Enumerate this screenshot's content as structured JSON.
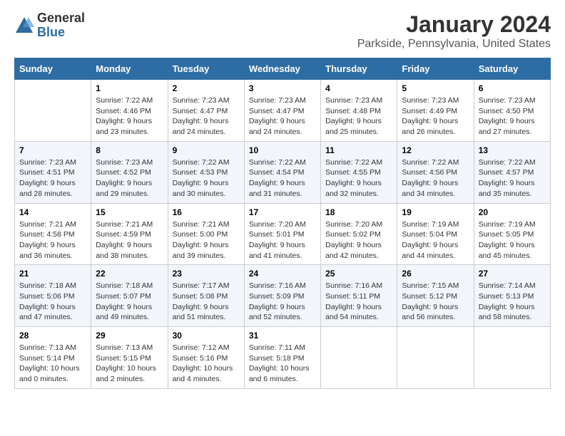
{
  "app": {
    "logo_general": "General",
    "logo_blue": "Blue"
  },
  "header": {
    "title": "January 2024",
    "subtitle": "Parkside, Pennsylvania, United States"
  },
  "calendar": {
    "columns": [
      "Sunday",
      "Monday",
      "Tuesday",
      "Wednesday",
      "Thursday",
      "Friday",
      "Saturday"
    ],
    "weeks": [
      [
        {
          "day": "",
          "info": ""
        },
        {
          "day": "1",
          "info": "Sunrise: 7:22 AM\nSunset: 4:46 PM\nDaylight: 9 hours\nand 23 minutes."
        },
        {
          "day": "2",
          "info": "Sunrise: 7:23 AM\nSunset: 4:47 PM\nDaylight: 9 hours\nand 24 minutes."
        },
        {
          "day": "3",
          "info": "Sunrise: 7:23 AM\nSunset: 4:47 PM\nDaylight: 9 hours\nand 24 minutes."
        },
        {
          "day": "4",
          "info": "Sunrise: 7:23 AM\nSunset: 4:48 PM\nDaylight: 9 hours\nand 25 minutes."
        },
        {
          "day": "5",
          "info": "Sunrise: 7:23 AM\nSunset: 4:49 PM\nDaylight: 9 hours\nand 26 minutes."
        },
        {
          "day": "6",
          "info": "Sunrise: 7:23 AM\nSunset: 4:50 PM\nDaylight: 9 hours\nand 27 minutes."
        }
      ],
      [
        {
          "day": "7",
          "info": "Sunrise: 7:23 AM\nSunset: 4:51 PM\nDaylight: 9 hours\nand 28 minutes."
        },
        {
          "day": "8",
          "info": "Sunrise: 7:23 AM\nSunset: 4:52 PM\nDaylight: 9 hours\nand 29 minutes."
        },
        {
          "day": "9",
          "info": "Sunrise: 7:22 AM\nSunset: 4:53 PM\nDaylight: 9 hours\nand 30 minutes."
        },
        {
          "day": "10",
          "info": "Sunrise: 7:22 AM\nSunset: 4:54 PM\nDaylight: 9 hours\nand 31 minutes."
        },
        {
          "day": "11",
          "info": "Sunrise: 7:22 AM\nSunset: 4:55 PM\nDaylight: 9 hours\nand 32 minutes."
        },
        {
          "day": "12",
          "info": "Sunrise: 7:22 AM\nSunset: 4:56 PM\nDaylight: 9 hours\nand 34 minutes."
        },
        {
          "day": "13",
          "info": "Sunrise: 7:22 AM\nSunset: 4:57 PM\nDaylight: 9 hours\nand 35 minutes."
        }
      ],
      [
        {
          "day": "14",
          "info": "Sunrise: 7:21 AM\nSunset: 4:58 PM\nDaylight: 9 hours\nand 36 minutes."
        },
        {
          "day": "15",
          "info": "Sunrise: 7:21 AM\nSunset: 4:59 PM\nDaylight: 9 hours\nand 38 minutes."
        },
        {
          "day": "16",
          "info": "Sunrise: 7:21 AM\nSunset: 5:00 PM\nDaylight: 9 hours\nand 39 minutes."
        },
        {
          "day": "17",
          "info": "Sunrise: 7:20 AM\nSunset: 5:01 PM\nDaylight: 9 hours\nand 41 minutes."
        },
        {
          "day": "18",
          "info": "Sunrise: 7:20 AM\nSunset: 5:02 PM\nDaylight: 9 hours\nand 42 minutes."
        },
        {
          "day": "19",
          "info": "Sunrise: 7:19 AM\nSunset: 5:04 PM\nDaylight: 9 hours\nand 44 minutes."
        },
        {
          "day": "20",
          "info": "Sunrise: 7:19 AM\nSunset: 5:05 PM\nDaylight: 9 hours\nand 45 minutes."
        }
      ],
      [
        {
          "day": "21",
          "info": "Sunrise: 7:18 AM\nSunset: 5:06 PM\nDaylight: 9 hours\nand 47 minutes."
        },
        {
          "day": "22",
          "info": "Sunrise: 7:18 AM\nSunset: 5:07 PM\nDaylight: 9 hours\nand 49 minutes."
        },
        {
          "day": "23",
          "info": "Sunrise: 7:17 AM\nSunset: 5:08 PM\nDaylight: 9 hours\nand 51 minutes."
        },
        {
          "day": "24",
          "info": "Sunrise: 7:16 AM\nSunset: 5:09 PM\nDaylight: 9 hours\nand 52 minutes."
        },
        {
          "day": "25",
          "info": "Sunrise: 7:16 AM\nSunset: 5:11 PM\nDaylight: 9 hours\nand 54 minutes."
        },
        {
          "day": "26",
          "info": "Sunrise: 7:15 AM\nSunset: 5:12 PM\nDaylight: 9 hours\nand 56 minutes."
        },
        {
          "day": "27",
          "info": "Sunrise: 7:14 AM\nSunset: 5:13 PM\nDaylight: 9 hours\nand 58 minutes."
        }
      ],
      [
        {
          "day": "28",
          "info": "Sunrise: 7:13 AM\nSunset: 5:14 PM\nDaylight: 10 hours\nand 0 minutes."
        },
        {
          "day": "29",
          "info": "Sunrise: 7:13 AM\nSunset: 5:15 PM\nDaylight: 10 hours\nand 2 minutes."
        },
        {
          "day": "30",
          "info": "Sunrise: 7:12 AM\nSunset: 5:16 PM\nDaylight: 10 hours\nand 4 minutes."
        },
        {
          "day": "31",
          "info": "Sunrise: 7:11 AM\nSunset: 5:18 PM\nDaylight: 10 hours\nand 6 minutes."
        },
        {
          "day": "",
          "info": ""
        },
        {
          "day": "",
          "info": ""
        },
        {
          "day": "",
          "info": ""
        }
      ]
    ]
  }
}
